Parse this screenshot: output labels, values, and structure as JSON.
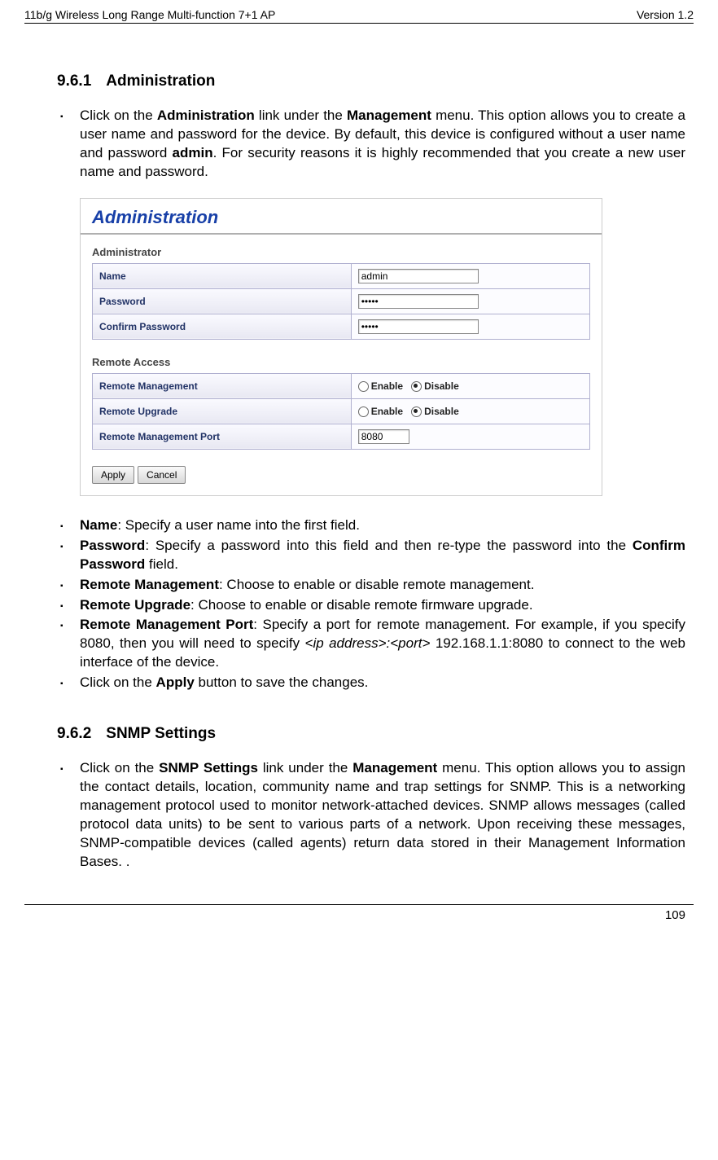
{
  "header": {
    "left": "11b/g Wireless Long Range Multi-function 7+1 AP",
    "right": "Version 1.2"
  },
  "section1": {
    "num": "9.6.1",
    "title": "Administration",
    "intro_parts": {
      "p1": "Click on the ",
      "b1": "Administration",
      "p2": " link under the ",
      "b2": "Management",
      "p3": " menu. This option allows you to create a user name and password for the device. By default, this device is configured without a user name and password ",
      "b3": "admin",
      "p4": ". For security reasons it is highly recommended that you create a new user name and password."
    }
  },
  "screenshot": {
    "title": "Administration",
    "group1": "Administrator",
    "rows1": {
      "name_label": "Name",
      "name_value": "admin",
      "password_label": "Password",
      "password_value": "•••••",
      "confirm_label": "Confirm Password",
      "confirm_value": "•••••"
    },
    "group2": "Remote Access",
    "rows2": {
      "rm_label": "Remote Management",
      "ru_label": "Remote Upgrade",
      "port_label": "Remote Management Port",
      "port_value": "8080",
      "enable": "Enable",
      "disable": "Disable"
    },
    "buttons": {
      "apply": "Apply",
      "cancel": "Cancel"
    }
  },
  "bullets1": {
    "b_name": "Name",
    "t_name": ": Specify a user name into the first field.",
    "b_pwd": "Password",
    "t_pwd1": ": Specify a password into this field and then re-type the password into the ",
    "b_pwd2": "Confirm Password",
    "t_pwd2": " field.",
    "b_rm": "Remote Management",
    "t_rm": ": Choose to enable or disable remote management.",
    "b_ru": "Remote Upgrade",
    "t_ru": ": Choose to enable or disable remote firmware upgrade.",
    "b_rmp": "Remote Management Port",
    "t_rmp1": ": Specify a port for remote management. For example, if you specify 8080, then you will need to specify ",
    "i_rmp": "<ip address>:<port>",
    "t_rmp2": " 192.168.1.1:8080 to connect to the web interface of the device.",
    "t_apply1": "Click on the ",
    "b_apply": "Apply",
    "t_apply2": " button to save the changes."
  },
  "section2": {
    "num": "9.6.2",
    "title": "SNMP Settings",
    "intro_parts": {
      "p1": "Click on the ",
      "b1": "SNMP Settings",
      "p2": " link under the ",
      "b2": "Management",
      "p3": " menu. This option allows you to assign the contact details, location, community name and trap settings for SNMP. This is a networking management protocol used to monitor network-attached devices. SNMP allows messages (called protocol data units) to be sent to various parts of a network. Upon receiving these messages, SNMP-compatible devices (called agents) return data stored in their Management Information Bases. ."
    }
  },
  "footer": {
    "page": "109"
  }
}
